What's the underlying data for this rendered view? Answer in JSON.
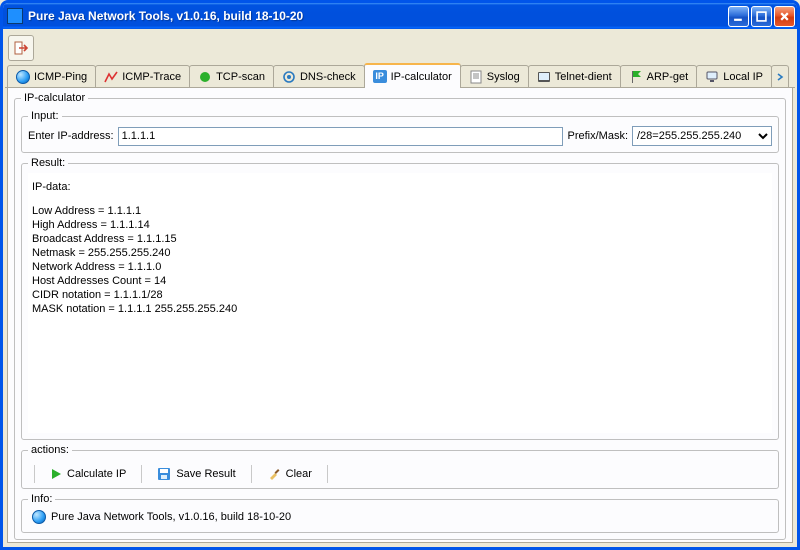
{
  "window": {
    "title": "Pure Java Network Tools,  v1.0.16, build 18-10-20"
  },
  "tabs": [
    {
      "label": "ICMP-Ping",
      "icon": "globe"
    },
    {
      "label": "ICMP-Trace",
      "icon": "trace"
    },
    {
      "label": "TCP-scan",
      "icon": "greendot"
    },
    {
      "label": "DNS-check",
      "icon": "dns"
    },
    {
      "label": "IP-calculator",
      "icon": "ip",
      "active": true
    },
    {
      "label": "Syslog",
      "icon": "doc"
    },
    {
      "label": "Telnet-dient",
      "icon": "term"
    },
    {
      "label": "ARP-get",
      "icon": "flag"
    },
    {
      "label": "Local IP",
      "icon": "pc"
    }
  ],
  "panel": {
    "groupbox_title": "IP-calculator",
    "input": {
      "legend": "Input:",
      "label": "Enter IP-address:",
      "value": "1.1.1.1",
      "prefix_label": "Prefix/Mask:",
      "prefix_value": "/28=255.255.255.240"
    },
    "result": {
      "legend": "Result:",
      "heading": "IP-data:",
      "lines": [
        "Low Address = 1.1.1.1",
        "High Address = 1.1.1.14",
        "Broadcast Address = 1.1.1.15",
        "Netmask = 255.255.255.240",
        "Network Address = 1.1.1.0",
        "Host Addresses Count = 14",
        "CIDR notation = 1.1.1.1/28",
        "MASK notation = 1.1.1.1 255.255.255.240"
      ]
    },
    "actions": {
      "legend": "actions:",
      "calculate": "Calculate IP",
      "save": "Save Result",
      "clear": "Clear"
    },
    "info": {
      "legend": "Info:",
      "text": "Pure Java Network Tools,  v1.0.16, build 18-10-20"
    }
  }
}
